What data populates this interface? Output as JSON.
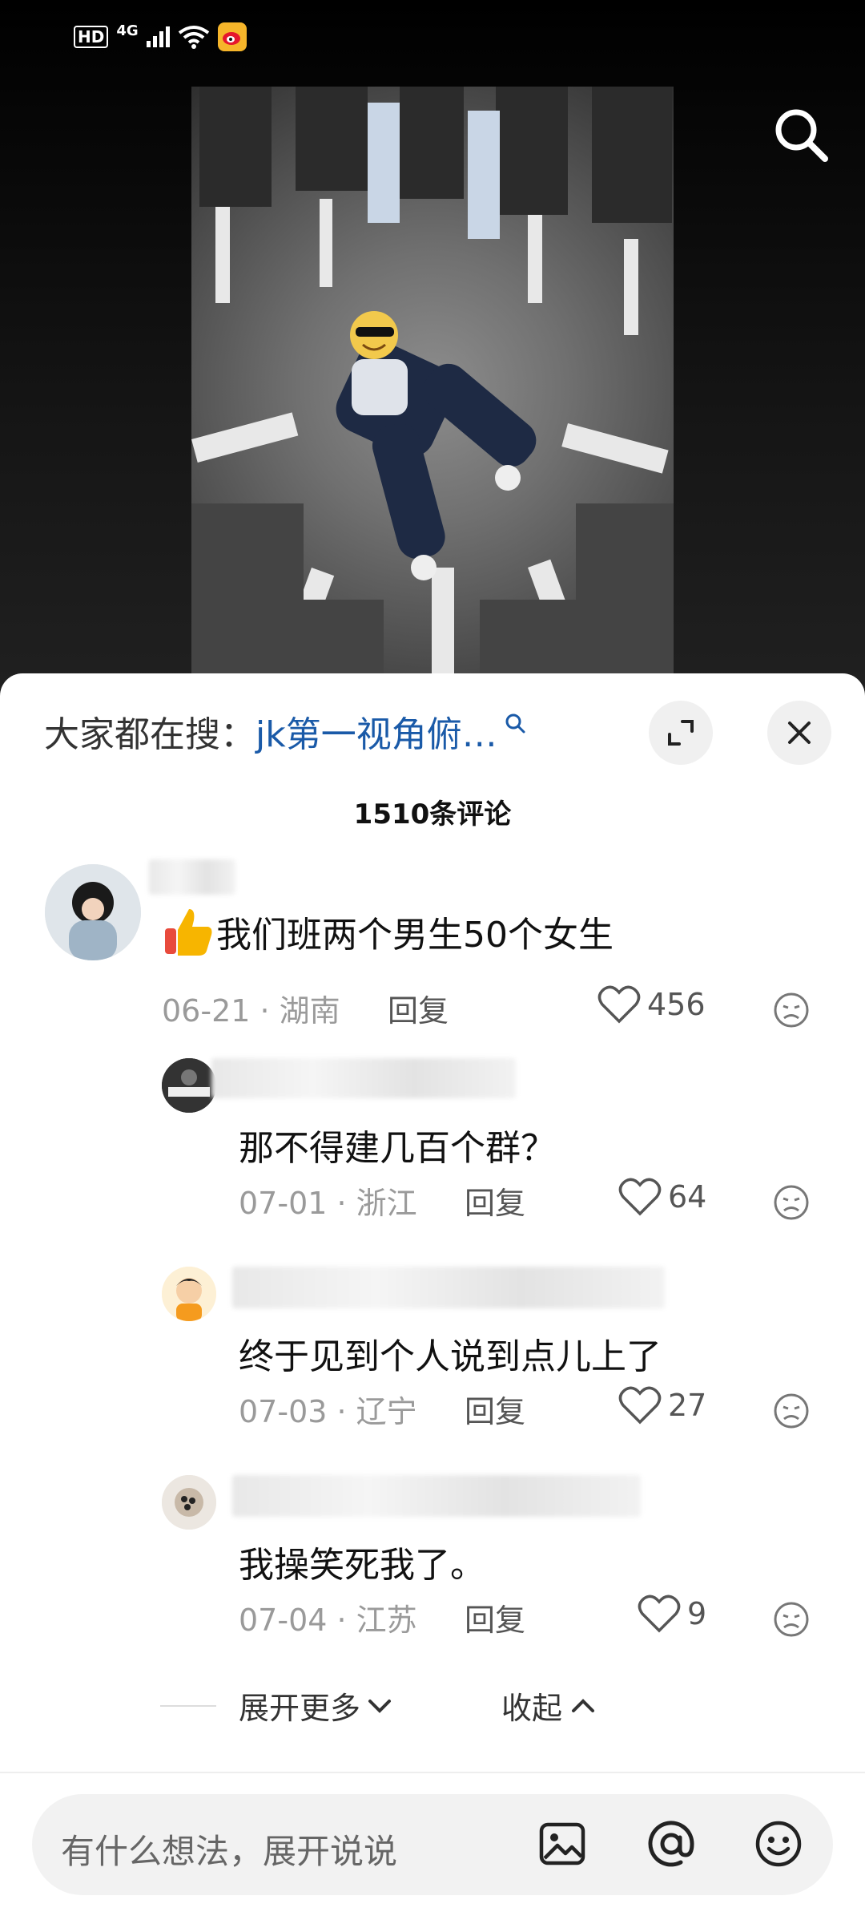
{
  "status_bar": {
    "hd": "HD",
    "network": "4G"
  },
  "video": {
    "search_icon": "search-icon"
  },
  "sheet": {
    "hot_search_prefix": "大家都在搜：",
    "hot_search_query": "jk第一视角俯…",
    "expand_icon": "expand-icon",
    "close_icon": "close-icon",
    "comment_count": "1510条评论"
  },
  "comments": [
    {
      "text": "我们班两个男生50个女生",
      "emoji": "thumbs-up-emoji",
      "date": "06-21 · 湖南",
      "reply": "回复",
      "likes": "456"
    },
    {
      "text": "那不得建几百个群？",
      "date": "07-01 · 浙江",
      "reply": "回复",
      "likes": "64"
    },
    {
      "text": "终于见到个人说到点儿上了",
      "date": "07-03 · 辽宁",
      "reply": "回复",
      "likes": "27"
    },
    {
      "text": "我操笑死我了。",
      "date": "07-04 · 江苏",
      "reply": "回复",
      "likes": "9"
    }
  ],
  "footer": {
    "expand_more": "展开更多",
    "collapse": "收起"
  },
  "input": {
    "placeholder": "有什么想法，展开说说"
  },
  "colors": {
    "link_blue": "#1a5aa8",
    "meta_gray": "#9a9a9a",
    "sheet_bg": "#ffffff",
    "video_bg": "#0e0e0e"
  }
}
